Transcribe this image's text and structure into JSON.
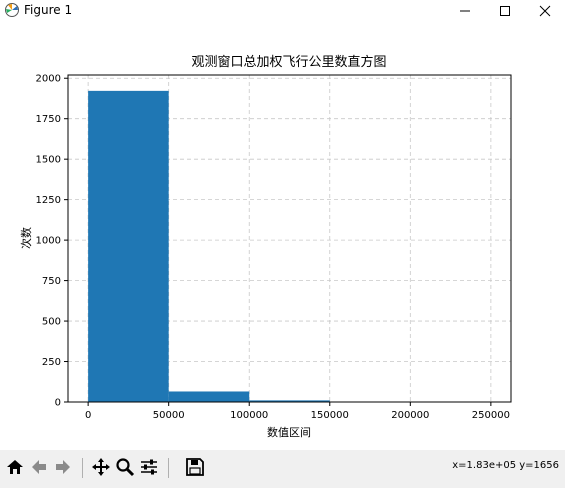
{
  "window": {
    "title": "Figure 1"
  },
  "toolbar": {
    "icons": [
      "home-icon",
      "back-icon",
      "forward-icon",
      "pan-icon",
      "zoom-icon",
      "configure-subplots-icon",
      "save-icon"
    ],
    "coord_text": "x=1.83e+05 y=1656"
  },
  "chart_data": {
    "type": "bar",
    "title": "观测窗口总加权飞行公里数直方图",
    "xlabel": "数值区间",
    "ylabel": "次数",
    "bins": [
      [
        0,
        50000
      ],
      [
        50000,
        100000
      ],
      [
        100000,
        150000
      ],
      [
        150000,
        200000
      ],
      [
        200000,
        250000
      ]
    ],
    "values": [
      1922,
      65,
      10,
      3,
      2
    ],
    "xlim": [
      -12500,
      262500
    ],
    "ylim": [
      0,
      2020
    ],
    "xticks": [
      0,
      50000,
      100000,
      150000,
      200000,
      250000
    ],
    "yticks": [
      0,
      250,
      500,
      750,
      1000,
      1250,
      1500,
      1750,
      2000
    ],
    "grid": true,
    "bar_color": "#1f77b4"
  }
}
